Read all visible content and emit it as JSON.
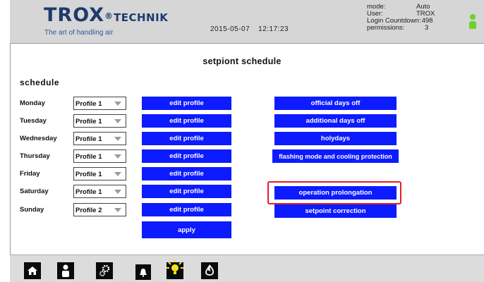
{
  "header": {
    "brand": "TROX",
    "brand_reg": "®",
    "brand_sub": "TECHNIK",
    "tagline": "The art of handling air",
    "date": "2015-05-07",
    "time": "12:17:23",
    "info": [
      {
        "key": "mode:",
        "value": "Auto"
      },
      {
        "key": "User:",
        "value": "TROX"
      },
      {
        "key": "Login Countdown:",
        "value": "498"
      },
      {
        "key": "permissions:",
        "value": "3"
      }
    ],
    "user_icon": "user-icon",
    "user_icon_color": "#6fcf2f"
  },
  "main": {
    "title": "setpiont schedule",
    "schedule_heading": "schedule",
    "days": [
      {
        "label": "Monday",
        "profile": "Profile 1",
        "edit": "edit profile"
      },
      {
        "label": "Tuesday",
        "profile": "Profile 1",
        "edit": "edit profile"
      },
      {
        "label": "Wednesday",
        "profile": "Profile 1",
        "edit": "edit profile"
      },
      {
        "label": "Thursday",
        "profile": "Profile 1",
        "edit": "edit profile"
      },
      {
        "label": "Friday",
        "profile": "Profile 1",
        "edit": "edit profile"
      },
      {
        "label": "Saturday",
        "profile": "Profile 1",
        "edit": "edit profile"
      },
      {
        "label": "Sunday",
        "profile": "Profile 2",
        "edit": "edit profile"
      }
    ],
    "apply_label": "apply",
    "right_buttons": [
      "official days off",
      "additional days off",
      "holydays",
      "flashing mode and cooling protection",
      "operation prolongation",
      "setpoint correction"
    ],
    "highlighted_button": "operation prolongation",
    "button_color": "#0d1bff",
    "highlight_color": "#e0202a"
  },
  "footer": {
    "icons": [
      "home-icon",
      "user-icon",
      "settings-icon",
      "alarm-bell-icon",
      "light-icon",
      "fire-icon"
    ]
  }
}
